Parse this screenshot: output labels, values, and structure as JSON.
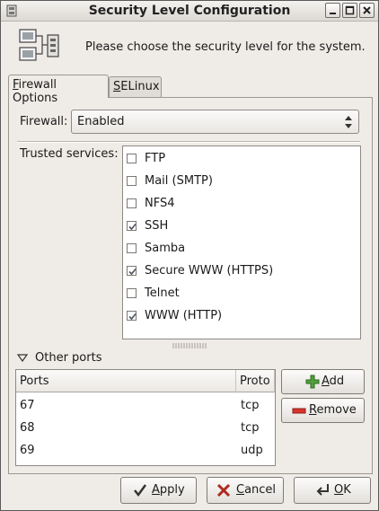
{
  "window": {
    "title": "Security Level Configuration",
    "controls": [
      "minimize",
      "maximize",
      "close"
    ]
  },
  "header": {
    "icon": "computer-network-icon",
    "text": "Please choose the security level for the system."
  },
  "tabs": [
    {
      "label_prefix": "",
      "mnemonic": "F",
      "label_rest": "irewall Options",
      "active": true
    },
    {
      "label_prefix": "",
      "mnemonic": "S",
      "label_rest": "ELinux",
      "active": false
    }
  ],
  "firewall": {
    "label": "Firewall:",
    "value": "Enabled"
  },
  "trusted": {
    "label": "Trusted services:",
    "services": [
      {
        "label": "FTP",
        "checked": false
      },
      {
        "label": "Mail (SMTP)",
        "checked": false
      },
      {
        "label": "NFS4",
        "checked": false
      },
      {
        "label": "SSH",
        "checked": true
      },
      {
        "label": "Samba",
        "checked": false
      },
      {
        "label": "Secure WWW (HTTPS)",
        "checked": true
      },
      {
        "label": "Telnet",
        "checked": false
      },
      {
        "label": "WWW (HTTP)",
        "checked": true
      }
    ]
  },
  "other_ports": {
    "label": "Other ports",
    "expanded": true,
    "columns": [
      "Ports",
      "Proto"
    ],
    "rows": [
      {
        "port": "67",
        "proto": "tcp"
      },
      {
        "port": "68",
        "proto": "tcp"
      },
      {
        "port": "69",
        "proto": "udp"
      }
    ],
    "add_mnemonic": "A",
    "add_rest": "dd",
    "remove_mnemonic": "R",
    "remove_rest": "emove"
  },
  "buttons": {
    "apply_mnemonic": "A",
    "apply_rest": "pply",
    "cancel_mnemonic": "C",
    "cancel_rest": "ancel",
    "ok_mnemonic": "O",
    "ok_rest": "K"
  },
  "colors": {
    "window_bg": "#efebe7",
    "add_icon": "#4fa13a",
    "remove_icon": "#d9352b",
    "cancel_icon": "#b02a20"
  }
}
